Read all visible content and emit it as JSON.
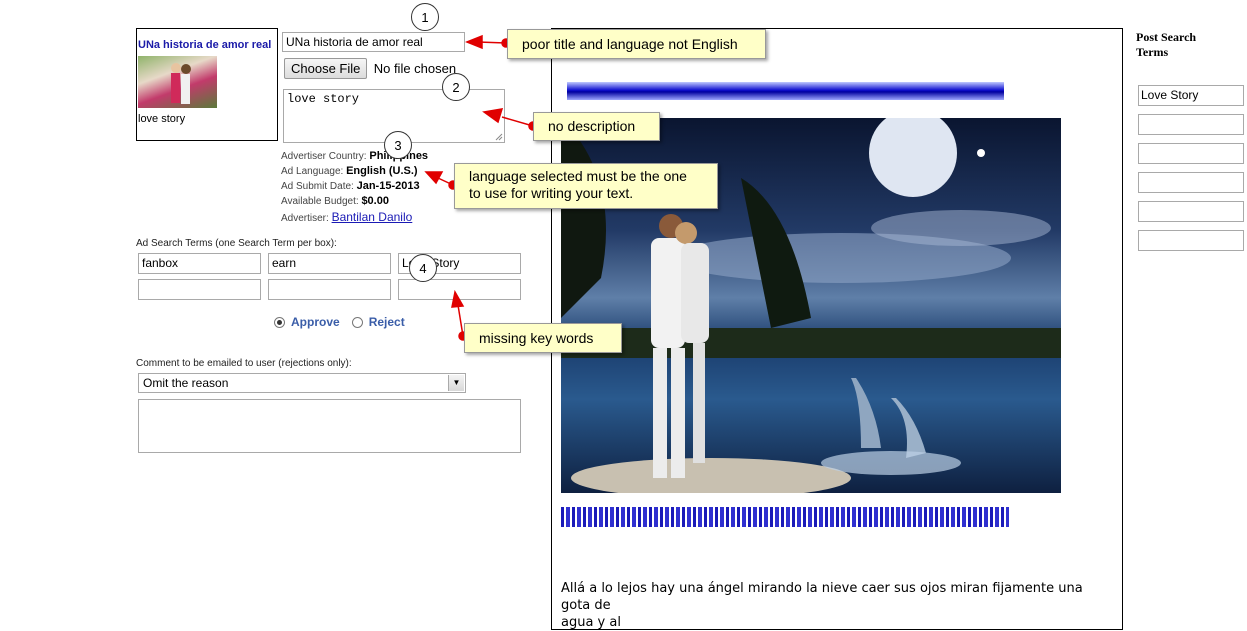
{
  "preview": {
    "title": "UNa historia de amor real",
    "description": "love story"
  },
  "form": {
    "title_value": "UNa historia de amor real",
    "choose_file_label": "Choose File",
    "no_file_text": "No file chosen",
    "description_value": "love story",
    "meta": {
      "country_label": "Advertiser Country:",
      "country_value": "Philippines",
      "language_label": "Ad Language:",
      "language_value": "English (U.S.)",
      "date_label": "Ad Submit Date:",
      "date_value": "Jan-15-2013",
      "budget_label": "Available Budget:",
      "budget_value": "$0.00",
      "advertiser_label": "Advertiser:",
      "advertiser_value": "Bantilan Danilo"
    },
    "search_terms_label": "Ad Search Terms (one Search Term per box):",
    "search_terms": [
      "fanbox",
      "earn",
      "Love Story",
      "",
      "",
      ""
    ],
    "approve_label": "Approve",
    "reject_label": "Reject",
    "approve_selected": true,
    "comment_label": "Comment to be emailed to user (rejections only):",
    "comment_select_value": "Omit the reason",
    "comment_text": ""
  },
  "callouts": {
    "c1": "poor title and language not English",
    "c2": "no description",
    "c3_line1": "language selected must be the one",
    "c3_line2": "to use for writing your text.",
    "c4": "missing key words",
    "n1": "1",
    "n2": "2",
    "n3": "3",
    "n4": "4"
  },
  "ad_content": {
    "body_text_line1": "Allá a lo lejos hay una ángel mirando la nieve caer sus ojos miran fijamente una gota de",
    "body_text_line2": "agua y al"
  },
  "sidebar": {
    "title_line1": "Post Search",
    "title_line2": "Terms",
    "terms": [
      "Love Story",
      "",
      "",
      "",
      "",
      ""
    ]
  },
  "colors": {
    "callout_bg": "#ffffc8",
    "arrow": "#e00000",
    "link": "#1a1ab5"
  }
}
